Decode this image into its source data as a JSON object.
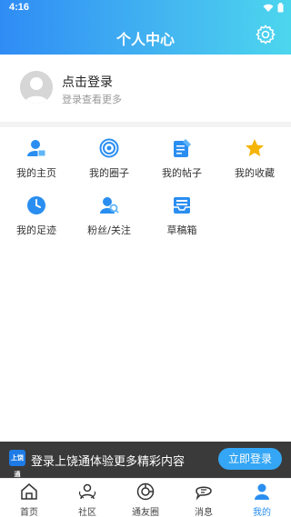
{
  "status_bar": {
    "time": "4:16"
  },
  "header": {
    "title": "个人中心"
  },
  "profile": {
    "title": "点击登录",
    "subtitle": "登录查看更多"
  },
  "menu": [
    {
      "label": "我的主页",
      "icon": "user-home-icon"
    },
    {
      "label": "我的圈子",
      "icon": "circle-target-icon"
    },
    {
      "label": "我的帖子",
      "icon": "post-edit-icon"
    },
    {
      "label": "我的收藏",
      "icon": "star-icon"
    },
    {
      "label": "我的足迹",
      "icon": "clock-icon"
    },
    {
      "label": "粉丝/关注",
      "icon": "fans-icon"
    },
    {
      "label": "草稿箱",
      "icon": "drafts-icon"
    }
  ],
  "banner": {
    "logo_text": "上饶通",
    "text": "登录上饶通体验更多精彩内容",
    "button": "立即登录"
  },
  "tabbar": [
    {
      "label": "首页",
      "icon": "home-icon",
      "active": false
    },
    {
      "label": "社区",
      "icon": "community-icon",
      "active": false
    },
    {
      "label": "通友圈",
      "icon": "friends-circle-icon",
      "active": false
    },
    {
      "label": "消息",
      "icon": "message-icon",
      "active": false
    },
    {
      "label": "我的",
      "icon": "me-icon",
      "active": true
    }
  ],
  "colors": {
    "primary": "#2a8ef0",
    "header_start": "#2f8cf5",
    "header_end": "#4cd6ee",
    "star": "#f5b400"
  }
}
